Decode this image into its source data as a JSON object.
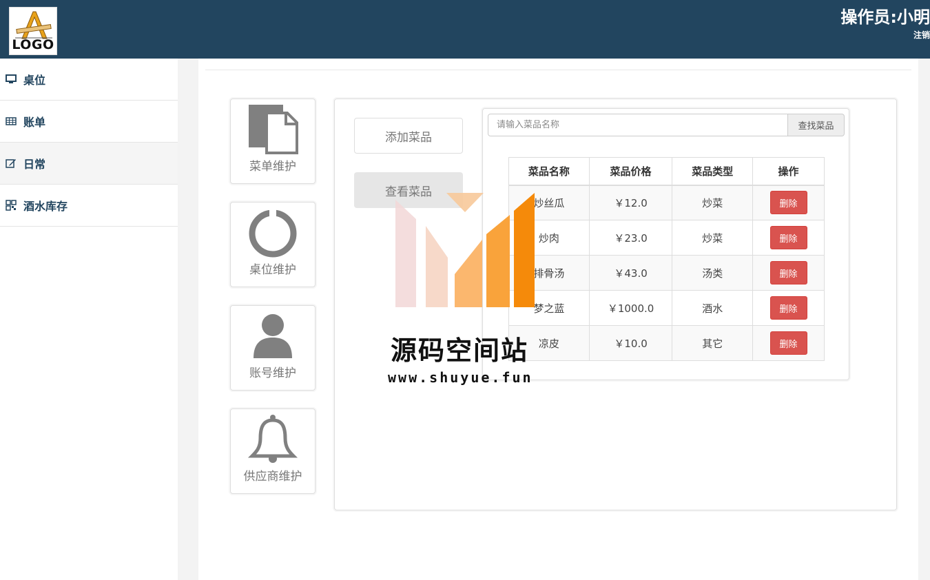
{
  "header": {
    "logo_text": "LOGO",
    "operator": "操作员:小明",
    "logout": "注销"
  },
  "sidebar": {
    "items": [
      {
        "label": "桌位",
        "icon": "monitor-icon"
      },
      {
        "label": "账单",
        "icon": "table-icon"
      },
      {
        "label": "日常",
        "icon": "edit-icon"
      },
      {
        "label": "酒水库存",
        "icon": "qrcode-icon"
      }
    ]
  },
  "tiles": [
    {
      "label": "菜单维护",
      "icon": "document-icon"
    },
    {
      "label": "桌位维护",
      "icon": "ring-icon"
    },
    {
      "label": "账号维护",
      "icon": "user-icon"
    },
    {
      "label": "供应商维护",
      "icon": "bell-icon"
    }
  ],
  "actions": {
    "add": "添加菜品",
    "view": "查看菜品"
  },
  "search": {
    "placeholder": "请输入菜品名称",
    "button": "查找菜品"
  },
  "table": {
    "headers": [
      "菜品名称",
      "菜品价格",
      "菜品类型",
      "操作"
    ],
    "rows": [
      {
        "name": "炒丝瓜",
        "price": "￥12.0",
        "type": "炒菜",
        "action": "删除"
      },
      {
        "name": "炒肉",
        "price": "￥23.0",
        "type": "炒菜",
        "action": "删除"
      },
      {
        "name": "排骨汤",
        "price": "￥43.0",
        "type": "汤类",
        "action": "删除"
      },
      {
        "name": "梦之蓝",
        "price": "￥1000.0",
        "type": "酒水",
        "action": "删除"
      },
      {
        "name": "凉皮",
        "price": "￥10.0",
        "type": "其它",
        "action": "删除"
      }
    ]
  },
  "watermark": {
    "title": "源码空间站",
    "url": "www.shuyue.fun"
  },
  "colors": {
    "header_bg": "#22455f",
    "delete_btn": "#d9534f",
    "icon_gray": "#808080"
  }
}
